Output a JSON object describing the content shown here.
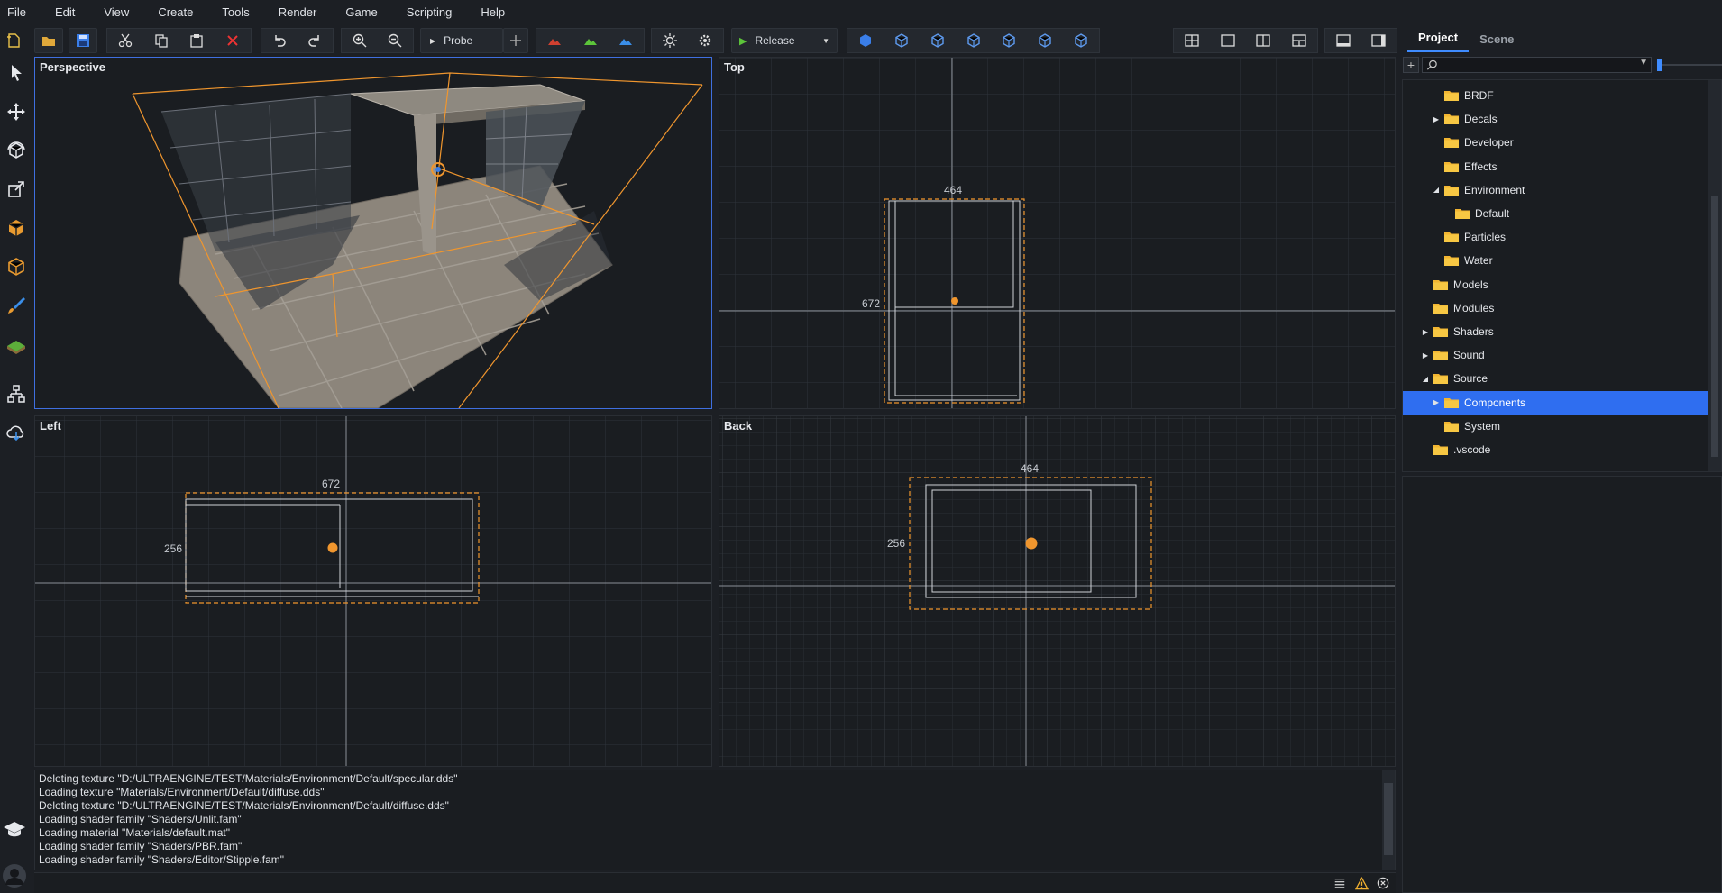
{
  "menu": [
    "File",
    "Edit",
    "View",
    "Create",
    "Tools",
    "Render",
    "Game",
    "Scripting",
    "Help"
  ],
  "toolbar": {
    "probe_label": "Probe",
    "release_label": "Release"
  },
  "viewports": {
    "perspective": "Perspective",
    "top": "Top",
    "left": "Left",
    "back": "Back",
    "top_width": "464",
    "top_depth": "672",
    "left_depth": "672",
    "left_height": "256",
    "back_width": "464",
    "back_height": "256"
  },
  "colors": {
    "accent": "#3f8cff",
    "selection_orange": "#f0962e",
    "selected_row": "#2f6ef0"
  },
  "console": [
    "Deleting texture \"D:/ULTRAENGINE/TEST/Materials/Environment/Default/specular.dds\"",
    "Loading texture \"Materials/Environment/Default/diffuse.dds\"",
    "Deleting texture \"D:/ULTRAENGINE/TEST/Materials/Environment/Default/diffuse.dds\"",
    "Loading shader family \"Shaders/Unlit.fam\"",
    "Loading material \"Materials/default.mat\"",
    "Loading shader family \"Shaders/PBR.fam\"",
    "Loading shader family \"Shaders/Editor/Stipple.fam\""
  ],
  "panel": {
    "tabs": [
      "Project",
      "Scene"
    ],
    "tree": [
      {
        "label": "BRDF",
        "indent": 2,
        "arrow": ""
      },
      {
        "label": "Decals",
        "indent": 2,
        "arrow": "right"
      },
      {
        "label": "Developer",
        "indent": 2,
        "arrow": ""
      },
      {
        "label": "Effects",
        "indent": 2,
        "arrow": ""
      },
      {
        "label": "Environment",
        "indent": 2,
        "arrow": "down"
      },
      {
        "label": "Default",
        "indent": 3,
        "arrow": ""
      },
      {
        "label": "Particles",
        "indent": 2,
        "arrow": ""
      },
      {
        "label": "Water",
        "indent": 2,
        "arrow": ""
      },
      {
        "label": "Models",
        "indent": 1,
        "arrow": ""
      },
      {
        "label": "Modules",
        "indent": 1,
        "arrow": ""
      },
      {
        "label": "Shaders",
        "indent": 1,
        "arrow": "right"
      },
      {
        "label": "Sound",
        "indent": 1,
        "arrow": "right"
      },
      {
        "label": "Source",
        "indent": 1,
        "arrow": "down"
      },
      {
        "label": "Components",
        "indent": 2,
        "arrow": "right",
        "selected": true
      },
      {
        "label": "System",
        "indent": 2,
        "arrow": ""
      },
      {
        "label": ".vscode",
        "indent": 1,
        "arrow": ""
      }
    ]
  }
}
